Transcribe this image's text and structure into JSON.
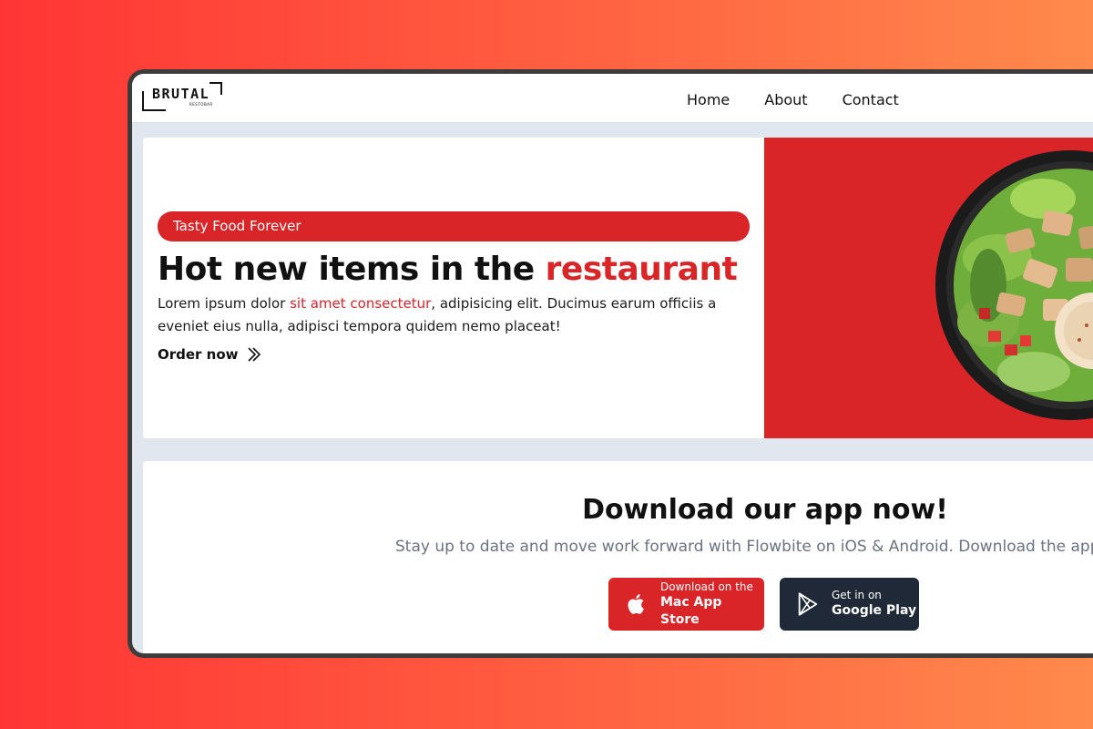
{
  "brand": {
    "logo_text": "BRUTAL",
    "logo_subtext": "RESTOBAR"
  },
  "nav": {
    "items": [
      {
        "label": "Home"
      },
      {
        "label": "About"
      },
      {
        "label": "Contact"
      }
    ]
  },
  "hero": {
    "tagline": "Tasty Food Forever",
    "title_main": "Hot new items in the ",
    "title_accent": "restaurant",
    "desc_before": "Lorem ipsum dolor ",
    "desc_link": "sit amet consectetur",
    "desc_after": ", adipisicing elit. Ducimus earum officiis a eveniet eius nulla, adipisci tempora quidem nemo placeat!",
    "cta_label": "Order now",
    "image_icon": "salad-bowl-image"
  },
  "download": {
    "title": "Download our app now!",
    "subtitle": "Stay up to date and move work forward with Flowbite on iOS & Android. Download the app today.",
    "apple": {
      "small": "Download on the",
      "big": "Mac App Store",
      "icon": "apple-icon"
    },
    "google": {
      "small": "Get in on",
      "big": "Google Play",
      "icon": "google-play-icon"
    }
  },
  "colors": {
    "accent": "#d92528",
    "dark": "#1f2937",
    "background_start": "#ff3535",
    "background_end": "#ff8a4c"
  }
}
